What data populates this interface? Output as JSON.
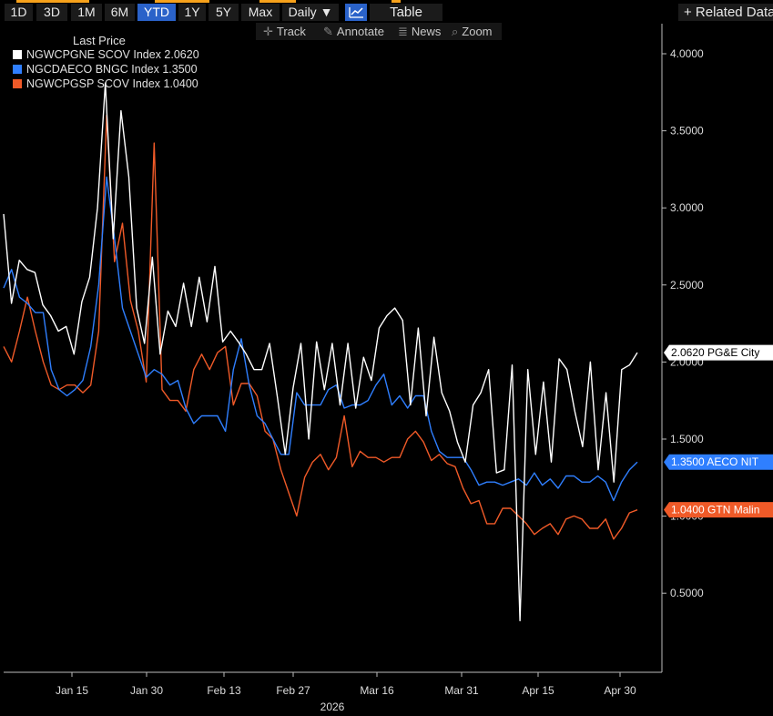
{
  "toolbar": {
    "ranges": [
      "1D",
      "3D",
      "1M",
      "6M",
      "YTD",
      "1Y",
      "5Y",
      "Max"
    ],
    "active_range": "YTD",
    "frequency": "Daily ▼",
    "table_label": "Table",
    "related_label": "+ Related Data",
    "chart_icon": "line-chart-icon"
  },
  "tools": {
    "track": "Track",
    "annotate": "Annotate",
    "news": "News",
    "zoom": "Zoom"
  },
  "legend": {
    "title": "Last Price",
    "entries": [
      {
        "label": "NGWCPGNE SCOV Index 2.0620",
        "color": "#ffffff"
      },
      {
        "label": "NGCDAECO BNGC Index 1.3500",
        "color": "#2f7fff"
      },
      {
        "label": "NGWCPGSP SCOV Index 1.0400",
        "color": "#f05a28"
      }
    ]
  },
  "chart_data": {
    "type": "line",
    "x_tick_labels": [
      "Jan 15",
      "Jan 30",
      "Feb 13",
      "Feb 27",
      "Mar 16",
      "Mar 31",
      "Apr 15",
      "Apr 30"
    ],
    "x_axis_year": "2026",
    "y_tick_labels": [
      "0.5000",
      "1.0000",
      "1.5000",
      "2.0000",
      "2.5000",
      "3.0000",
      "3.5000",
      "4.0000"
    ],
    "ylim": [
      0,
      4.2
    ],
    "xlim": [
      0,
      80
    ],
    "series": [
      {
        "name": "NGWCPGNE SCOV Index",
        "color": "#ffffff",
        "last_tag": "2.0620 PG&E City",
        "values": [
          2.96,
          2.38,
          2.66,
          2.6,
          2.58,
          2.37,
          2.3,
          2.2,
          2.23,
          2.05,
          2.39,
          2.55,
          3.0,
          3.81,
          2.8,
          3.63,
          3.2,
          2.35,
          2.12,
          2.68,
          2.05,
          2.33,
          2.23,
          2.51,
          2.23,
          2.55,
          2.26,
          2.62,
          2.13,
          2.2,
          2.13,
          2.05,
          1.95,
          1.95,
          2.12,
          1.77,
          1.4,
          1.83,
          2.12,
          1.5,
          2.13,
          1.82,
          2.12,
          1.72,
          2.12,
          1.7,
          2.03,
          1.88,
          2.22,
          2.3,
          2.35,
          2.27,
          1.72,
          2.22,
          1.65,
          2.16,
          1.8,
          1.68,
          1.48,
          1.35,
          1.72,
          1.8,
          1.95,
          1.28,
          1.3,
          1.98,
          0.32,
          1.95,
          1.4,
          1.87,
          1.35,
          2.02,
          1.95,
          1.68,
          1.45,
          2.0,
          1.3,
          1.8,
          1.22,
          1.95,
          1.98,
          2.06
        ]
      },
      {
        "name": "NGCDAECO BNGC Index",
        "color": "#2f7fff",
        "last_tag": "1.3500 AECO NIT",
        "values": [
          2.48,
          2.6,
          2.42,
          2.38,
          2.32,
          2.32,
          1.95,
          1.82,
          1.78,
          1.82,
          1.88,
          2.1,
          2.5,
          3.2,
          2.8,
          2.35,
          2.2,
          2.05,
          1.9,
          1.95,
          1.92,
          1.85,
          1.88,
          1.7,
          1.6,
          1.65,
          1.65,
          1.65,
          1.55,
          1.95,
          2.15,
          1.85,
          1.65,
          1.6,
          1.5,
          1.4,
          1.4,
          1.8,
          1.72,
          1.72,
          1.72,
          1.82,
          1.85,
          1.7,
          1.72,
          1.72,
          1.75,
          1.85,
          1.92,
          1.72,
          1.78,
          1.7,
          1.78,
          1.78,
          1.55,
          1.42,
          1.38,
          1.38,
          1.38,
          1.3,
          1.2,
          1.22,
          1.22,
          1.2,
          1.22,
          1.24,
          1.2,
          1.28,
          1.2,
          1.24,
          1.18,
          1.26,
          1.26,
          1.22,
          1.22,
          1.26,
          1.22,
          1.1,
          1.22,
          1.3,
          1.35
        ]
      },
      {
        "name": "NGWCPGSP SCOV Index",
        "color": "#f05a28",
        "last_tag": "1.0400 GTN Malin",
        "values": [
          2.1,
          2.0,
          2.2,
          2.42,
          2.2,
          2.0,
          1.85,
          1.82,
          1.85,
          1.85,
          1.8,
          1.85,
          2.2,
          3.6,
          2.65,
          2.9,
          2.4,
          2.2,
          1.87,
          3.42,
          1.82,
          1.75,
          1.75,
          1.68,
          1.95,
          2.05,
          1.95,
          2.06,
          2.1,
          1.72,
          1.86,
          1.86,
          1.78,
          1.55,
          1.5,
          1.3,
          1.15,
          1.0,
          1.25,
          1.35,
          1.4,
          1.3,
          1.38,
          1.65,
          1.32,
          1.42,
          1.38,
          1.38,
          1.35,
          1.38,
          1.38,
          1.5,
          1.55,
          1.48,
          1.36,
          1.4,
          1.34,
          1.32,
          1.18,
          1.08,
          1.1,
          0.95,
          0.95,
          1.05,
          1.05,
          1.0,
          0.95,
          0.88,
          0.92,
          0.95,
          0.88,
          0.98,
          1.0,
          0.98,
          0.92,
          0.92,
          0.98,
          0.85,
          0.92,
          1.02,
          1.04
        ]
      }
    ]
  }
}
